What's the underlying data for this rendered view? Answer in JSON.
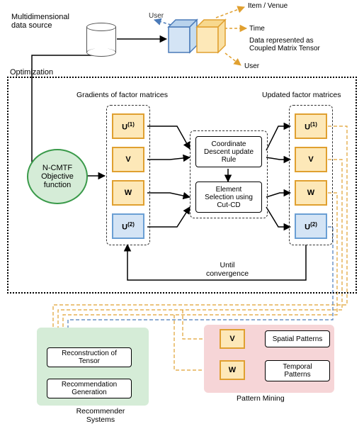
{
  "top": {
    "source_label": "Multidimensional\ndata source",
    "user_label": "User",
    "item_label": "Item / Venue",
    "time_label": "Time",
    "repr_label": "Data represented as\nCoupled Matrix Tensor",
    "user_down": "User"
  },
  "optimization_label": "Optimization",
  "objective": "N-CMTF\nObjective\nfunction",
  "gradients_title": "Gradients of factor matrices",
  "updated_title": "Updated factor matrices",
  "matrices": {
    "u1": "U(1)",
    "v": "V",
    "w": "W",
    "u2": "U(2)"
  },
  "center": {
    "coord": "Coordinate\nDescent update\nRule",
    "elem": "Element\nSelection using\nCut-CD"
  },
  "until": "Until\nconvergence",
  "recsys": {
    "title": "Recommender\nSystems",
    "recon": "Reconstruction of\nTensor",
    "gen": "Recommendation\nGeneration"
  },
  "pattern": {
    "title": "Pattern Mining",
    "spatial": "Spatial Patterns",
    "temporal": "Temporal\nPatterns"
  }
}
